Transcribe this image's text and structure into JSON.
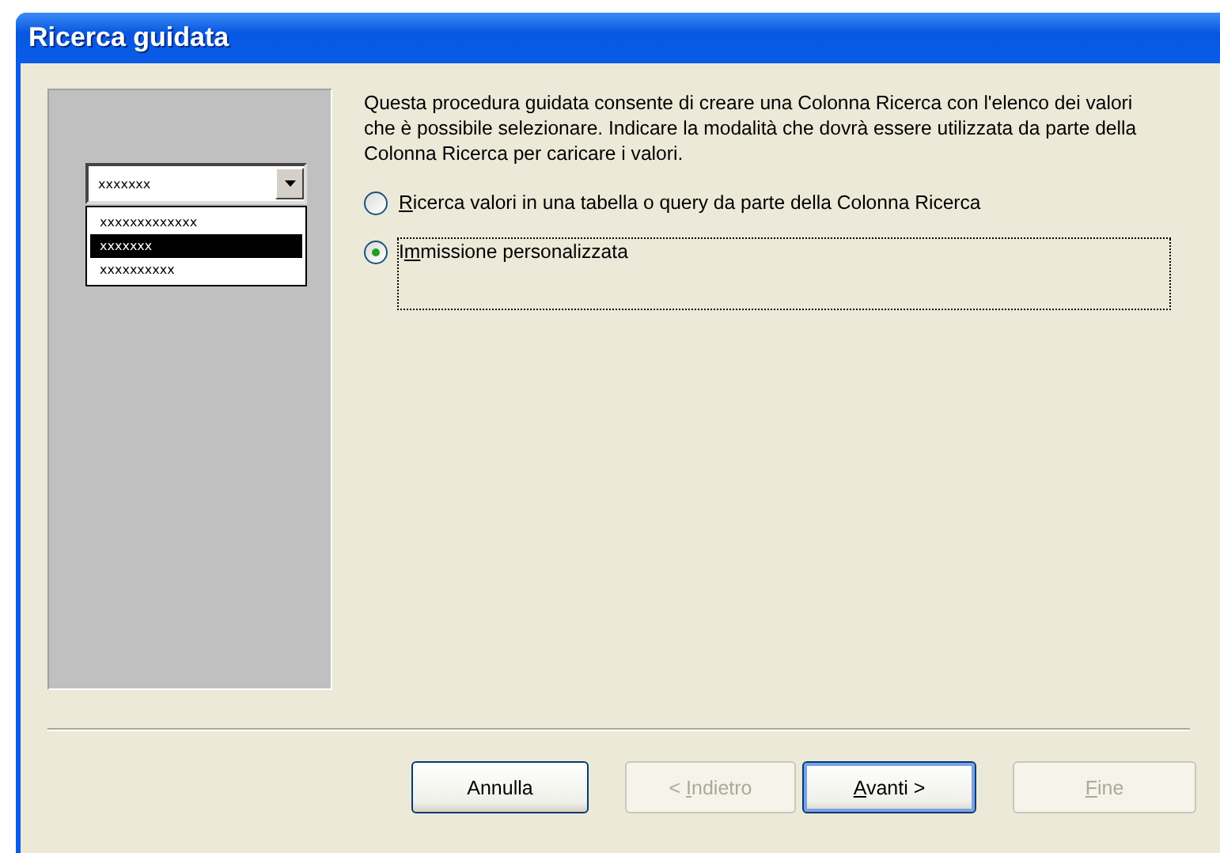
{
  "window": {
    "title": "Ricerca guidata"
  },
  "illustration": {
    "combo_value": "xxxxxxx",
    "list_items": [
      {
        "text": "xxxxxxxxxxxxx",
        "selected": false
      },
      {
        "text": "xxxxxxx",
        "selected": true
      },
      {
        "text": "xxxxxxxxxx",
        "selected": false
      }
    ]
  },
  "description": "Questa procedura guidata consente di creare una Colonna Ricerca con l'elenco dei valori che è possibile selezionare. Indicare la modalità che dovrà essere utilizzata da parte della Colonna Ricerca per caricare i valori.",
  "options": [
    {
      "label": {
        "key": "R",
        "post": "icerca valori in una tabella o query da parte della Colonna Ricerca"
      },
      "selected": false
    },
    {
      "label": {
        "pre": "I",
        "key": "m",
        "post": "missione personalizzata"
      },
      "selected": true
    }
  ],
  "buttons": [
    {
      "label": {
        "pre": "Annulla"
      },
      "disabled": false,
      "default": false
    },
    {
      "label": {
        "pre": "< ",
        "key": "I",
        "post": "ndietro"
      },
      "disabled": true,
      "default": false
    },
    {
      "label": {
        "key": "A",
        "post": "vanti >"
      },
      "disabled": false,
      "default": true
    },
    {
      "label": {
        "key": "F",
        "post": "ine"
      },
      "disabled": true,
      "default": false
    }
  ]
}
